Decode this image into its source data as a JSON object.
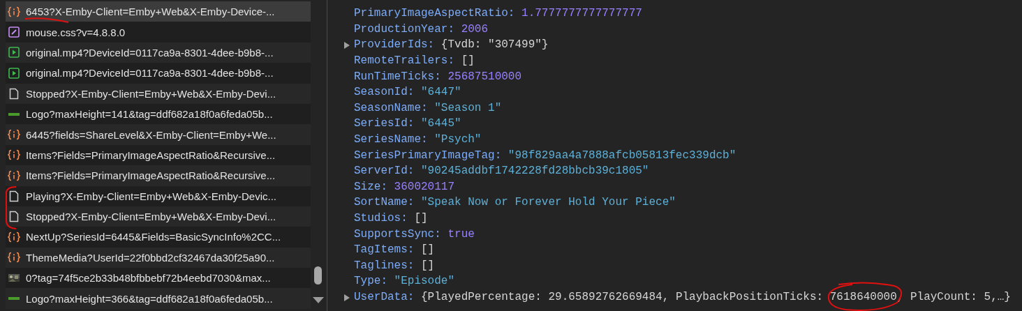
{
  "requests": [
    {
      "name": "6453?X-Emby-Client=Emby+Web&X-Emby-Device-...",
      "kind": "fetch",
      "selected": true
    },
    {
      "name": "mouse.css?v=4.8.8.0",
      "kind": "stylesheet",
      "selected": false
    },
    {
      "name": "original.mp4?DeviceId=0117ca9a-8301-4dee-b9b8-...",
      "kind": "media",
      "selected": false
    },
    {
      "name": "original.mp4?DeviceId=0117ca9a-8301-4dee-b9b8-...",
      "kind": "media",
      "selected": false
    },
    {
      "name": "Stopped?X-Emby-Client=Emby+Web&X-Emby-Devi...",
      "kind": "document",
      "selected": false
    },
    {
      "name": "Logo?maxHeight=141&tag=ddf682a18f0a6feda05b...",
      "kind": "logo",
      "selected": false
    },
    {
      "name": "6445?fields=ShareLevel&X-Emby-Client=Emby+We...",
      "kind": "fetch",
      "selected": false
    },
    {
      "name": "Items?Fields=PrimaryImageAspectRatio&Recursive...",
      "kind": "fetch",
      "selected": false
    },
    {
      "name": "Items?Fields=PrimaryImageAspectRatio&Recursive...",
      "kind": "fetch",
      "selected": false
    },
    {
      "name": "Playing?X-Emby-Client=Emby+Web&X-Emby-Devic...",
      "kind": "document",
      "selected": false
    },
    {
      "name": "Stopped?X-Emby-Client=Emby+Web&X-Emby-Devi...",
      "kind": "document",
      "selected": false
    },
    {
      "name": "NextUp?SeriesId=6445&Fields=BasicSyncInfo%2CC...",
      "kind": "fetch",
      "selected": false
    },
    {
      "name": "ThemeMedia?UserId=22f0bbd2cf32467da30f25a90...",
      "kind": "fetch",
      "selected": false
    },
    {
      "name": "0?tag=74f5ce2b33b48bfbbebf72b4eebd7030&max...",
      "selected": false
    },
    {
      "name": "Logo?maxHeight=366&tag=ddf682a18f0a6feda05b...",
      "kind": "logo",
      "selected": false
    }
  ],
  "ink_marks": [
    {
      "kind": "underline"
    },
    {
      "kind": "bracket"
    },
    {
      "kind": "circle"
    }
  ],
  "properties": [
    {
      "key": "PrimaryImageAspectRatio:",
      "value": "1.7777777777777777",
      "kind": "number",
      "expandable": false
    },
    {
      "key": "ProductionYear:",
      "value": "2006",
      "kind": "number",
      "expandable": false
    },
    {
      "key": "ProviderIds:",
      "value": "{Tvdb: \"307499\"}",
      "kind": "object",
      "expandable": true
    },
    {
      "key": "RemoteTrailers:",
      "value": "[]",
      "kind": "object",
      "expandable": false
    },
    {
      "key": "RunTimeTicks:",
      "value": "25687510000",
      "kind": "number",
      "expandable": false
    },
    {
      "key": "SeasonId:",
      "value": "\"6447\"",
      "kind": "string",
      "expandable": false
    },
    {
      "key": "SeasonName:",
      "value": "\"Season 1\"",
      "kind": "string",
      "expandable": false
    },
    {
      "key": "SeriesId:",
      "value": "\"6445\"",
      "kind": "string",
      "expandable": false
    },
    {
      "key": "SeriesName:",
      "value": "\"Psych\"",
      "kind": "string",
      "expandable": false
    },
    {
      "key": "SeriesPrimaryImageTag:",
      "value": "\"98f829aa4a7888afcb05813fec339dcb\"",
      "kind": "string",
      "expandable": false
    },
    {
      "key": "ServerId:",
      "value": "\"90245addbf1742228fd28bbcb39c1805\"",
      "kind": "string",
      "expandable": false
    },
    {
      "key": "Size:",
      "value": "360020117",
      "kind": "number",
      "expandable": false
    },
    {
      "key": "SortName:",
      "value": "\"Speak Now or Forever Hold Your Piece\"",
      "kind": "string",
      "expandable": false
    },
    {
      "key": "Studios:",
      "value": "[]",
      "kind": "object",
      "expandable": false
    },
    {
      "key": "SupportsSync:",
      "value": "true",
      "kind": "number",
      "expandable": false
    },
    {
      "key": "TagItems:",
      "value": "[]",
      "kind": "object",
      "expandable": false
    },
    {
      "key": "Taglines:",
      "value": "[]",
      "kind": "object",
      "expandable": false
    },
    {
      "key": "Type:",
      "value": "\"Episode\"",
      "kind": "string",
      "expandable": false
    },
    {
      "key": "UserData:",
      "value": "{PlayedPercentage: 29.65892762669484, PlaybackPositionTicks: ",
      "marked": "7618640000",
      "value_after": ", PlayCount: 5,…}",
      "kind": "object",
      "expandable": true
    }
  ]
}
